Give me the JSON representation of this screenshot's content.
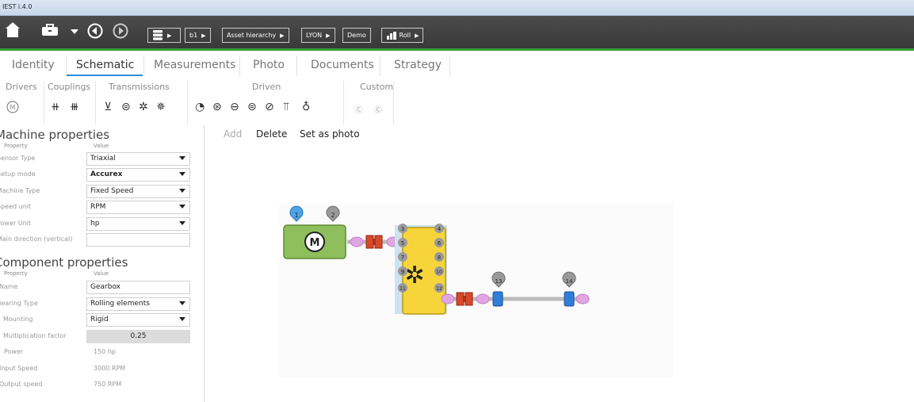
{
  "window": {
    "title": "IEST i.4.0"
  },
  "toolbar": {
    "icons": [
      "home-icon",
      "toolbox-icon",
      "chevron-down-icon",
      "back-icon",
      "forward-icon",
      "database-icon"
    ],
    "breadcrumbs": [
      "b1",
      "Asset hierarchy",
      "LYON",
      "Demo",
      "Roll"
    ]
  },
  "tabs": [
    "Identity",
    "Schematic",
    "Measurements",
    "Photo",
    "Documents",
    "Strategy"
  ],
  "active_tab": "Schematic",
  "palette": {
    "groups": [
      "Drivers",
      "Couplings",
      "Transmissions",
      "Driven",
      "Custom"
    ]
  },
  "machine_properties": {
    "title": "Machine properties",
    "col_property": "Property",
    "col_value": "Value",
    "rows": [
      {
        "label": "Sensor Type",
        "value": "Triaxial"
      },
      {
        "label": "Setup mode",
        "value": "Accurex"
      },
      {
        "label": "Machine Type",
        "value": "Fixed Speed"
      },
      {
        "label": "Speed unit",
        "value": "RPM"
      },
      {
        "label": "Power Unit",
        "value": "hp"
      },
      {
        "label": "Main direction (vertical)",
        "value": ""
      }
    ]
  },
  "component_properties": {
    "title": "Component properties",
    "col_property": "Property",
    "col_value": "Value",
    "rows": [
      {
        "label": "Name",
        "value": "Gearbox"
      },
      {
        "label": "Bearing Type",
        "value": "Rolling elements"
      },
      {
        "label": "Mounting",
        "value": "Rigid"
      },
      {
        "label": "Multiplication factor",
        "value": "0.25"
      },
      {
        "label": "Power",
        "value": "150 hp"
      },
      {
        "label": "Input Speed",
        "value": "3000 RPM"
      },
      {
        "label": "Output speed",
        "value": "750 RPM"
      }
    ]
  },
  "actions": {
    "add": "Add",
    "delete": "Delete",
    "set_photo": "Set as photo"
  },
  "schematic": {
    "motor_label": "M",
    "points": [
      "1",
      "2",
      "3",
      "4",
      "5",
      "6",
      "7",
      "8",
      "9",
      "10",
      "11",
      "12",
      "13",
      "14"
    ],
    "colors": {
      "motor": "#8fbf5c",
      "gearbox": "#f7d53a",
      "coupling": "#d8492a",
      "bearing": "#2e7fd8",
      "selected_point": "#4ea3e8",
      "point": "#9a9a9a"
    }
  }
}
